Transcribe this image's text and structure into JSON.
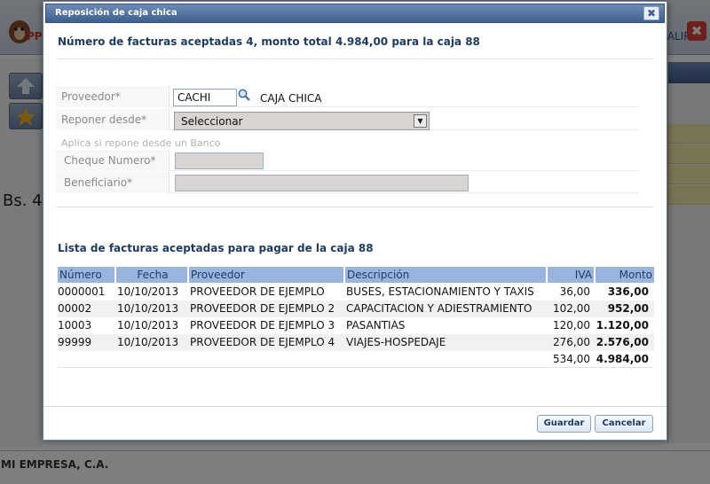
{
  "background": {
    "logo_text": "PP",
    "salir_label": "SALIR",
    "close_label": "✖",
    "amount_text": "Bs. 4",
    "company": "MI EMPRESA, C.A."
  },
  "dialog": {
    "title": "Reposición de caja chica",
    "close_label": "✖",
    "summary": "Número de facturas aceptadas 4, monto total 4.984,00 para la caja 88",
    "form": {
      "proveedor_label": "Proveedor*",
      "proveedor_code": "CACHI",
      "proveedor_name": "CAJA CHICA",
      "reponer_label": "Reponer desde*",
      "reponer_value": "Seleccionar",
      "hint": "Aplica si repone desde un Banco",
      "cheque_label": "Cheque Numero*",
      "cheque_value": "",
      "beneficiario_label": "Beneficiario*",
      "beneficiario_value": ""
    },
    "list_title": "Lista de facturas aceptadas para pagar de la caja 88",
    "table": {
      "headers": [
        "Número",
        "Fecha",
        "Proveedor",
        "Descripción",
        "IVA",
        "Monto"
      ],
      "rows": [
        [
          "0000001",
          "10/10/2013",
          "PROVEEDOR DE EJEMPLO",
          "BUSES, ESTACIONAMIENTO Y TAXIS",
          "36,00",
          "336,00"
        ],
        [
          "00002",
          "10/10/2013",
          "PROVEEDOR DE EJEMPLO 2",
          "CAPACITACION Y ADIESTRAMIENTO",
          "102,00",
          "952,00"
        ],
        [
          "10003",
          "10/10/2013",
          "PROVEEDOR DE EJEMPLO 3",
          "PASANTIAS",
          "120,00",
          "1.120,00"
        ],
        [
          "99999",
          "10/10/2013",
          "PROVEEDOR DE EJEMPLO 4",
          "VIAJES-HOSPEDAJE",
          "276,00",
          "2.576,00"
        ]
      ],
      "totals": {
        "iva": "534,00",
        "monto": "4.984,00"
      }
    },
    "buttons": {
      "save": "Guardar",
      "cancel": "Cancelar"
    }
  }
}
